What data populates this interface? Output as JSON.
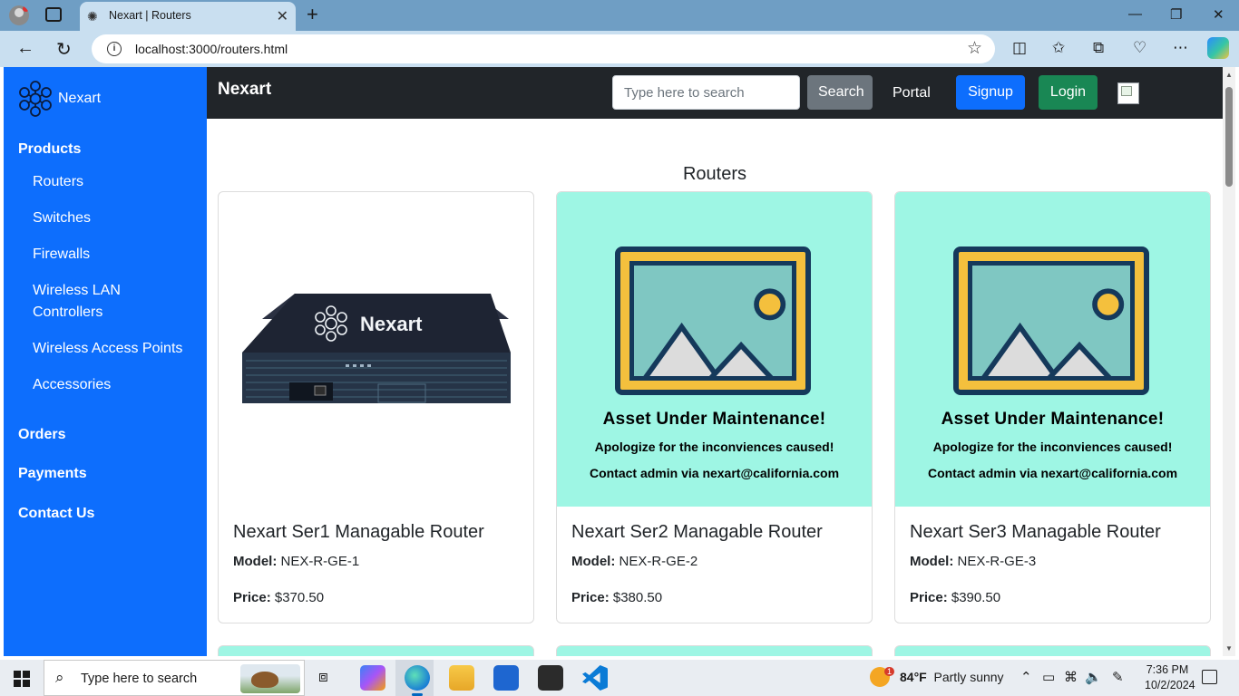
{
  "browser": {
    "tab_title": "Nexart | Routers",
    "url": "localhost:3000/routers.html"
  },
  "sidebar": {
    "brand": "Nexart",
    "sections": [
      {
        "label": "Products",
        "items": [
          "Routers",
          "Switches",
          "Firewalls",
          "Wireless LAN Controllers",
          "Wireless Access Points",
          "Accessories"
        ]
      },
      {
        "label": "Orders"
      },
      {
        "label": "Payments"
      },
      {
        "label": "Contact Us"
      }
    ]
  },
  "navbar": {
    "brand": "Nexart",
    "search_placeholder": "Type here to search",
    "search_button": "Search",
    "portal_link": "Portal",
    "signup_button": "Signup",
    "login_button": "Login"
  },
  "main": {
    "title": "Routers",
    "products": [
      {
        "name": "Nexart Ser1 Managable Router",
        "model_label": "Model:",
        "model": "NEX-R-GE-1",
        "price_label": "Price:",
        "price": "$370.50",
        "image": "router-photo",
        "image_brand": "Nexart"
      },
      {
        "name": "Nexart Ser2 Managable Router",
        "model_label": "Model:",
        "model": "NEX-R-GE-2",
        "price_label": "Price:",
        "price": "$380.50",
        "image": "maintenance-placeholder"
      },
      {
        "name": "Nexart Ser3 Managable Router",
        "model_label": "Model:",
        "model": "NEX-R-GE-3",
        "price_label": "Price:",
        "price": "$390.50",
        "image": "maintenance-placeholder"
      }
    ],
    "maintenance": {
      "headline": "Asset Under Maintenance!",
      "apology": "Apologize for the inconviences caused!",
      "contact": "Contact admin via nexart@california.com"
    }
  },
  "taskbar": {
    "search_placeholder": "Type here to search",
    "weather_temp": "84°F",
    "weather_desc": "Partly sunny",
    "weather_badge": "1",
    "time": "7:36 PM",
    "date": "10/2/2024"
  },
  "colors": {
    "sidebar_bg": "#0d6efd",
    "navbar_bg": "#212529",
    "signup_bg": "#0d6efd",
    "login_bg": "#198754",
    "search_btn_bg": "#6c757d",
    "maintenance_bg": "#9ef6e4"
  }
}
